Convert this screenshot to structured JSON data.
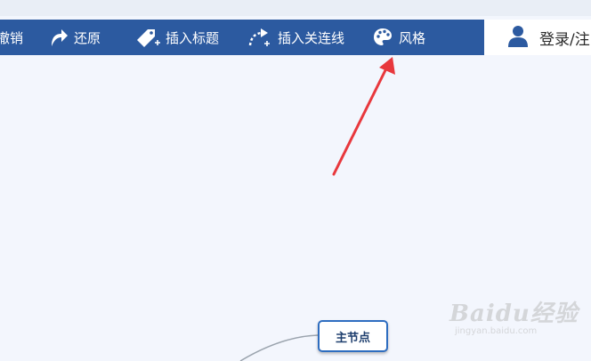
{
  "toolbar": {
    "undo_label": "撤销",
    "redo_label": "还原",
    "insert_title_label": "插入标题",
    "insert_connector_label": "插入关连线",
    "style_label": "风格",
    "login_label": "登录/注"
  },
  "canvas": {
    "main_node_label": "主节点"
  },
  "watermark": {
    "brand": "Baidu经验",
    "url": "jingyan.baidu.com"
  },
  "icons": [
    "redo-icon",
    "tag-plus-icon",
    "connector-plus-icon",
    "palette-icon",
    "user-icon"
  ],
  "colors": {
    "toolbar_bg": "#2c5aa0",
    "canvas_bg": "#f3f6fd",
    "node_border": "#2e6dc0",
    "arrow": "#e8383d"
  }
}
